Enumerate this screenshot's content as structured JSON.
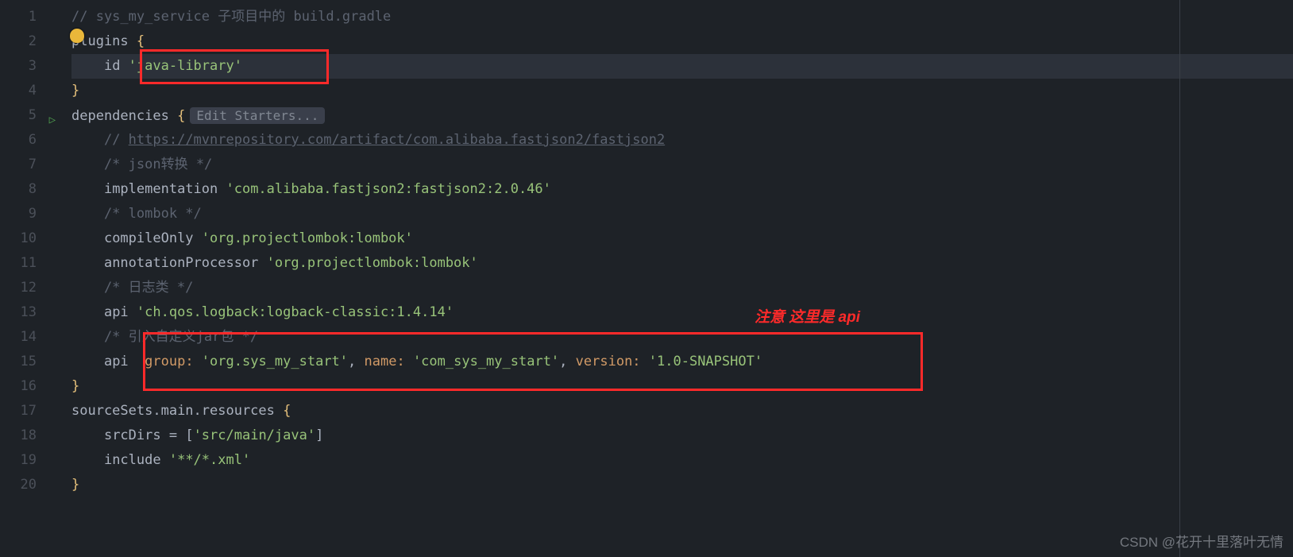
{
  "gutter": {
    "lines": [
      "1",
      "2",
      "3",
      "4",
      "5",
      "6",
      "7",
      "8",
      "9",
      "10",
      "11",
      "12",
      "13",
      "14",
      "15",
      "16",
      "17",
      "18",
      "19",
      "20"
    ],
    "run_icon_line": 5
  },
  "hint": {
    "edit_starters": "Edit Starters..."
  },
  "code": {
    "l1_comment": "// sys_my_service 子项目中的 build.gradle",
    "l2_plugins": "plugins",
    "l2_brace": " {",
    "l3_indent": "    ",
    "l3_id": "id ",
    "l3_str": "'java-library'",
    "l4_close": "}",
    "l5_dep": "dependencies",
    "l5_brace": " {",
    "l6_indent": "    ",
    "l6_slashes": "// ",
    "l6_link": "https://mvnrepository.com/artifact/com.alibaba.fastjson2/fastjson2",
    "l7": "    /* json转换 */",
    "l8_indent": "    ",
    "l8_impl": "implementation ",
    "l8_str": "'com.alibaba.fastjson2:fastjson2:2.0.46'",
    "l9": "    /* lombok */",
    "l10_indent": "    ",
    "l10_co": "compileOnly ",
    "l10_str": "'org.projectlombok:lombok'",
    "l11_indent": "    ",
    "l11_ap": "annotationProcessor ",
    "l11_str": "'org.projectlombok:lombok'",
    "l12": "    /* 日志类 */",
    "l13_indent": "    ",
    "l13_api": "api ",
    "l13_str": "'ch.qos.logback:logback-classic:1.4.14'",
    "l14": "    /* 引入自定义jar包 */",
    "l15_indent": "    ",
    "l15_api": "api  ",
    "l15_group_k": "group: ",
    "l15_group_v": "'org.sys_my_start'",
    "l15_c1": ", ",
    "l15_name_k": "name: ",
    "l15_name_v": "'com_sys_my_start'",
    "l15_c2": ", ",
    "l15_ver_k": "version: ",
    "l15_ver_v": "'1.0-SNAPSHOT'",
    "l16_close": "}",
    "l17_ss": "sourceSets",
    "l17_main": ".main.resources ",
    "l17_brace": "{",
    "l18_indent": "    ",
    "l18_sd": "srcDirs",
    "l18_eq": " = [",
    "l18_str": "'src/main/java'",
    "l18_end": "]",
    "l19_indent": "    ",
    "l19_inc": "include ",
    "l19_str": "'**/*.xml'",
    "l20_close": "}"
  },
  "annotation": "注意 这里是 api",
  "watermark": "CSDN @花开十里落叶无情"
}
